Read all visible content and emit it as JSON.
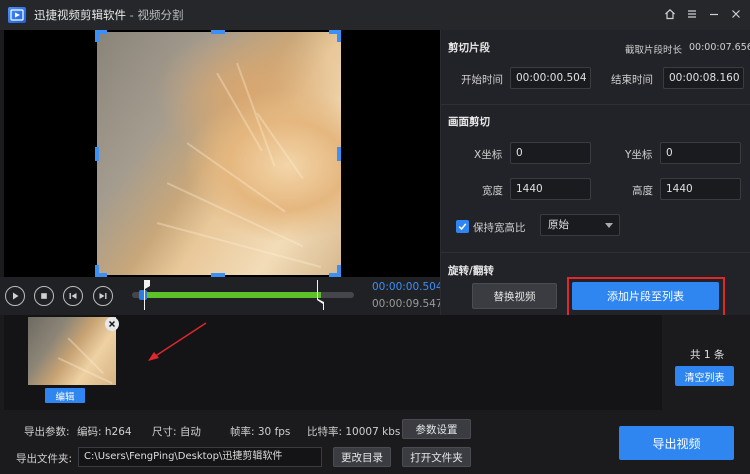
{
  "window": {
    "app_name": "迅捷视频剪辑软件",
    "separator": " - ",
    "subtitle": "视频分割"
  },
  "player": {
    "current_time": "00:00:00.504",
    "total_time": "00:00:09.547",
    "progress_fraction": 0.05,
    "selection_start_fraction": 0.05,
    "selection_end_fraction": 0.85
  },
  "cut_segment": {
    "title": "剪切片段",
    "duration_label": "截取片段时长",
    "duration_value": "00:00:07.656",
    "start_label": "开始时间",
    "start_value": "00:00:00.504",
    "end_label": "结束时间",
    "end_value": "00:00:08.160"
  },
  "crop": {
    "title": "画面剪切",
    "x_label": "X坐标",
    "x_value": "0",
    "y_label": "Y坐标",
    "y_value": "0",
    "width_label": "宽度",
    "width_value": "1440",
    "height_label": "高度",
    "height_value": "1440",
    "keep_ratio_label": "保持宽高比",
    "keep_ratio_checked": true,
    "ratio_option": "原始"
  },
  "rotate": {
    "title": "旋转/翻转"
  },
  "actions": {
    "replace_video": "替换视频",
    "add_to_list": "添加片段至列表"
  },
  "clips": {
    "edit_label": "编辑",
    "count_text": "共 1 条",
    "clear_list": "清空列表"
  },
  "export": {
    "params_label": "导出参数:",
    "codec": "编码: h264",
    "size": "尺寸: 自动",
    "fps": "帧率: 30 fps",
    "bitrate": "比特率: 10007 kbs",
    "param_settings": "参数设置",
    "folder_label": "导出文件夹:",
    "folder_path": "C:\\Users\\FengPing\\Desktop\\迅捷剪辑软件",
    "change_dir": "更改目录",
    "open_folder": "打开文件夹",
    "export_video": "导出视频"
  },
  "colors": {
    "accent": "#2f86f0",
    "progress": "#5fc12a",
    "highlight_box": "#e0272a"
  }
}
